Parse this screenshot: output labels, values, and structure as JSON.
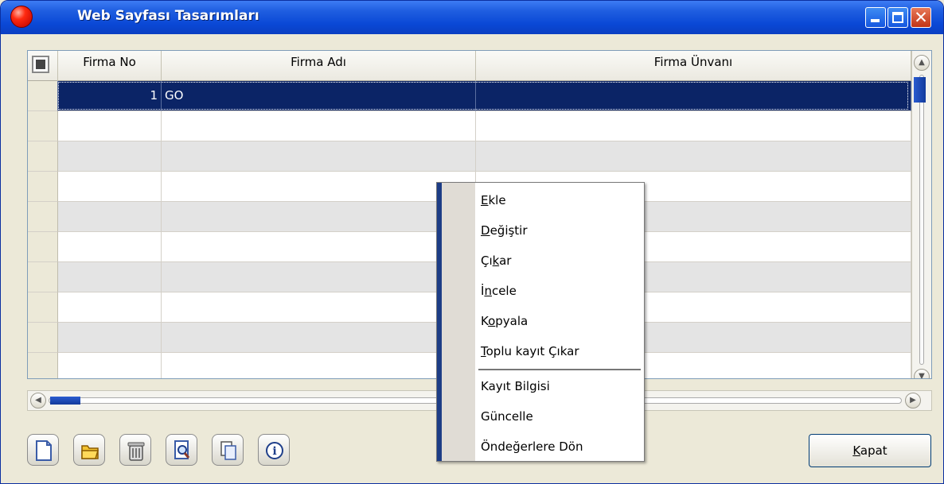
{
  "window": {
    "title": "Web Sayfası Tasarımları"
  },
  "grid": {
    "columns": [
      "Firma No",
      "Firma Adı",
      "Firma Ünvanı"
    ],
    "rows": [
      {
        "firma_no": "1",
        "firma_adi": "GO",
        "firma_unvani": ""
      }
    ]
  },
  "context_menu": {
    "items": [
      {
        "label": "Ekle",
        "mnemonic": "E"
      },
      {
        "label": "Değiştir",
        "mnemonic": "D"
      },
      {
        "label": "Çıkar",
        "mnemonic": "k"
      },
      {
        "label": "İncele",
        "mnemonic": "n"
      },
      {
        "label": "Kopyala",
        "mnemonic": "o"
      },
      {
        "label": "Toplu kayıt Çıkar",
        "mnemonic": "T"
      },
      {
        "label": "Kayıt Bilgisi",
        "mnemonic": ""
      },
      {
        "label": "Güncelle",
        "mnemonic": ""
      },
      {
        "label": "Öndeğerlere Dön",
        "mnemonic": ""
      }
    ]
  },
  "toolbar": {
    "icons": [
      "new-document-icon",
      "open-folder-icon",
      "delete-trash-icon",
      "preview-magnifier-icon",
      "copy-icon",
      "info-icon"
    ]
  },
  "buttons": {
    "close_label": "Kapat"
  }
}
